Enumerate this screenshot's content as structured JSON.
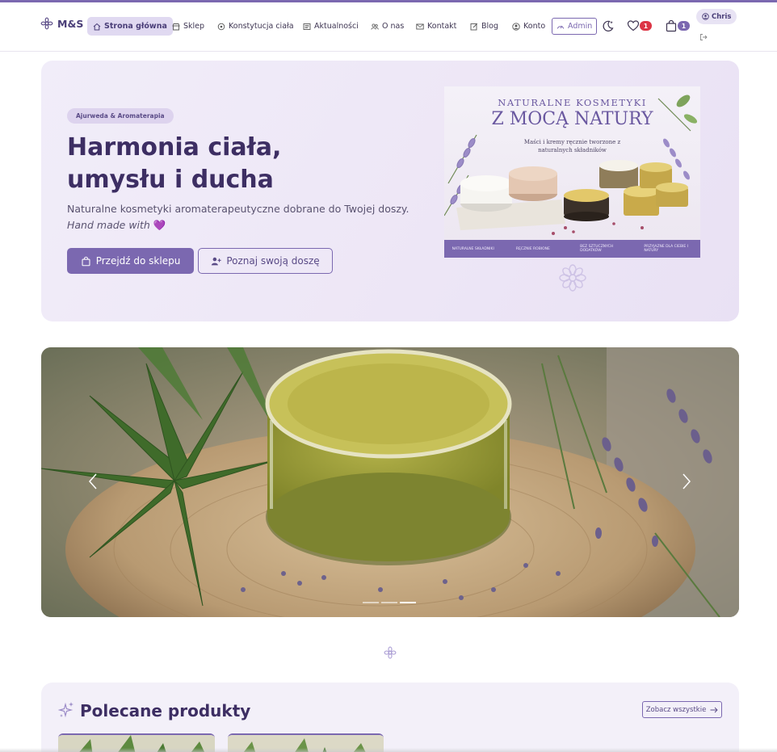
{
  "brand": {
    "name": "M&S"
  },
  "nav": {
    "items": [
      {
        "label": "Strona główna",
        "active": true
      },
      {
        "label": "Sklep"
      },
      {
        "label": "Konstytucja ciała"
      },
      {
        "label": "Aktualności"
      },
      {
        "label": "O nas"
      },
      {
        "label": "Kontakt"
      },
      {
        "label": "Blog"
      },
      {
        "label": "Konto"
      }
    ],
    "admin_label": "Admin",
    "wishlist_count": "1",
    "cart_count": "1",
    "user_name": "Chris"
  },
  "hero": {
    "badge": "Ajurweda & Aromaterapia",
    "title_line1": "Harmonia ciała,",
    "title_line2": "umysłu i ducha",
    "subtitle": "Naturalne kosmetyki aromaterapeutyczne dobrane do Twojej doszy.",
    "subtitle_em": "Hand made with",
    "primary_button": "Przejdź do sklepu",
    "secondary_button": "Poznaj swoją doszę",
    "promo": {
      "line1": "NATURALNE KOSMETYKI",
      "line2": "Z MOCĄ NATURY",
      "line3": "Maści i kremy ręcznie tworzone z naturalnych składników",
      "features": [
        "NATURALNE SKŁADNIKI",
        "RĘCZNIE ROBIONE",
        "BEZ SZTUCZNYCH DODATKÓW",
        "PRZYJAZNE DLA CIEBIE I NATURY"
      ]
    }
  },
  "carousel": {
    "slide_count": 3,
    "active_slide": 3
  },
  "featured": {
    "title": "Polecane produkty",
    "see_all": "Zobacz wszystkie"
  },
  "colors": {
    "accent": "#7b68b0",
    "hero_bg": "#efeaf8",
    "title": "#3d2e63",
    "badge_red": "#dc3545"
  }
}
